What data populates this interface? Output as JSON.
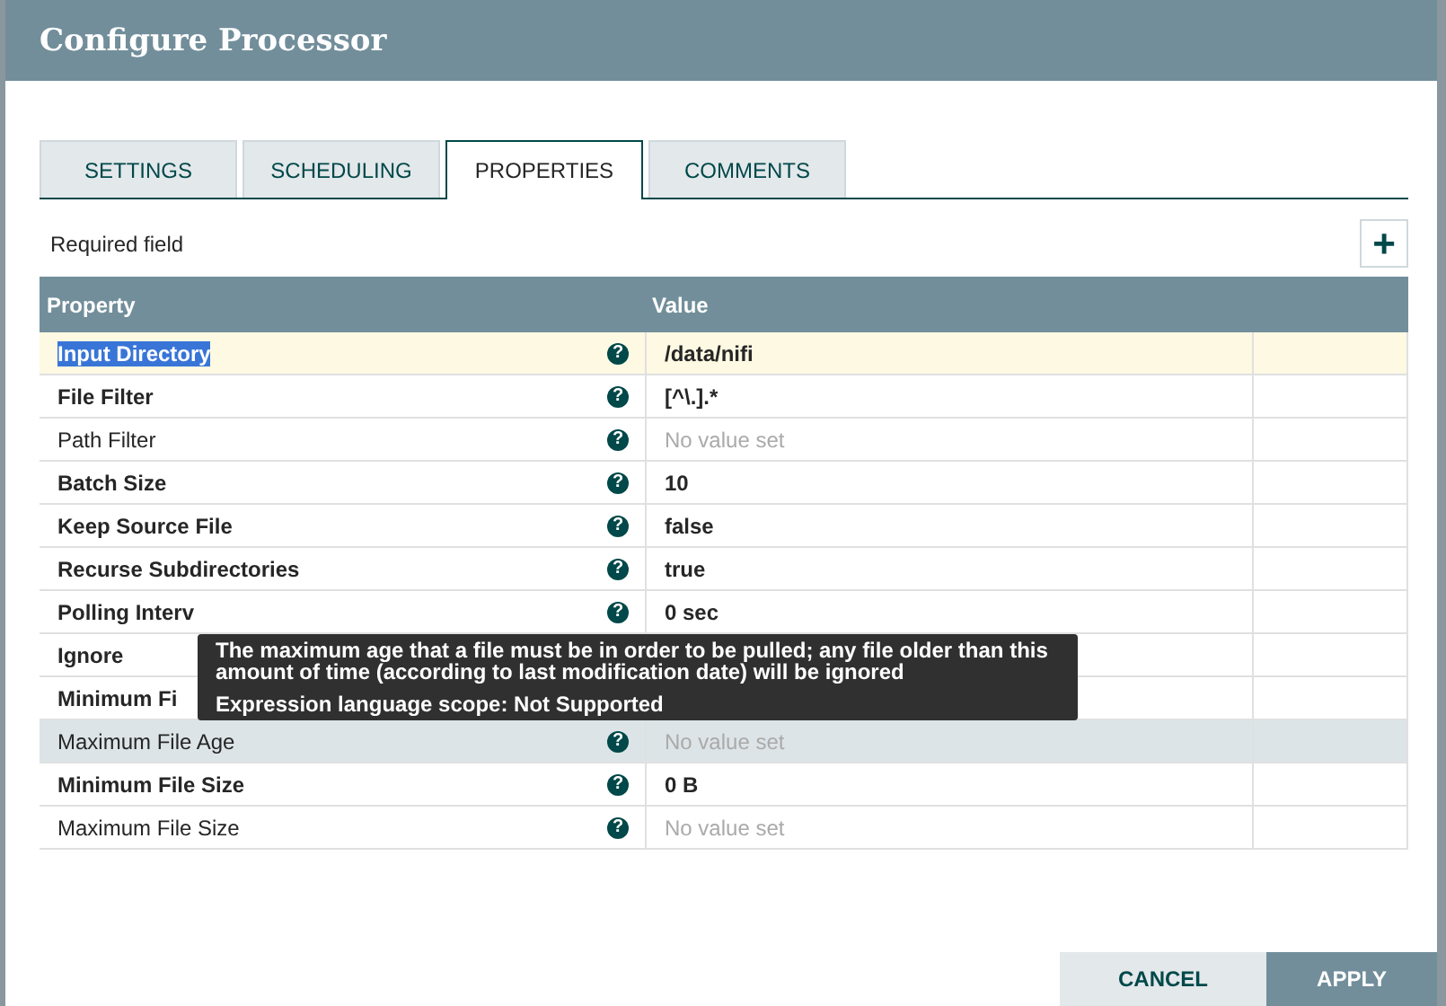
{
  "dialog": {
    "title": "Configure Processor"
  },
  "tabs": [
    {
      "label": "SETTINGS",
      "selected": false
    },
    {
      "label": "SCHEDULING",
      "selected": false
    },
    {
      "label": "PROPERTIES",
      "selected": true
    },
    {
      "label": "COMMENTS",
      "selected": false
    }
  ],
  "legend": "Required field",
  "help_icon": "?",
  "add_button": "+",
  "table": {
    "columns": [
      "Property",
      "Value"
    ],
    "rows": [
      {
        "name": "Input Directory",
        "required": true,
        "value": "/data/nifi",
        "value_set": true,
        "selected": true,
        "hovered": false
      },
      {
        "name": "File Filter",
        "required": true,
        "value": "[^\\.].*",
        "value_set": true,
        "selected": false,
        "hovered": false
      },
      {
        "name": "Path Filter",
        "required": false,
        "value": "No value set",
        "value_set": false,
        "selected": false,
        "hovered": false
      },
      {
        "name": "Batch Size",
        "required": true,
        "value": "10",
        "value_set": true,
        "selected": false,
        "hovered": false
      },
      {
        "name": "Keep Source File",
        "required": true,
        "value": "false",
        "value_set": true,
        "selected": false,
        "hovered": false
      },
      {
        "name": "Recurse Subdirectories",
        "required": true,
        "value": "true",
        "value_set": true,
        "selected": false,
        "hovered": false
      },
      {
        "name": "Polling Interv",
        "required": true,
        "value": "0 sec",
        "value_set": true,
        "selected": false,
        "hovered": false
      },
      {
        "name": "Ignore",
        "required": true,
        "selected": false,
        "hovered": false
      },
      {
        "name": "Minimum Fi",
        "required": true,
        "selected": false,
        "hovered": false
      },
      {
        "name": "Maximum File Age",
        "required": false,
        "value": "No value set",
        "value_set": false,
        "selected": false,
        "hovered": true
      },
      {
        "name": "Minimum File Size",
        "required": true,
        "value": "0 B",
        "value_set": true,
        "selected": false,
        "hovered": false
      },
      {
        "name": "Maximum File Size",
        "required": false,
        "value": "No value set",
        "value_set": false,
        "selected": false,
        "hovered": false
      }
    ]
  },
  "tooltip": {
    "description": "The maximum age that a file must be in order to be pulled; any file older than this amount of time (according to last modification date) will be ignored",
    "scope": "Expression language scope: Not Supported"
  },
  "buttons": [
    {
      "label": "CANCEL",
      "kind": "secondary"
    },
    {
      "label": "APPLY",
      "kind": "primary"
    }
  ]
}
